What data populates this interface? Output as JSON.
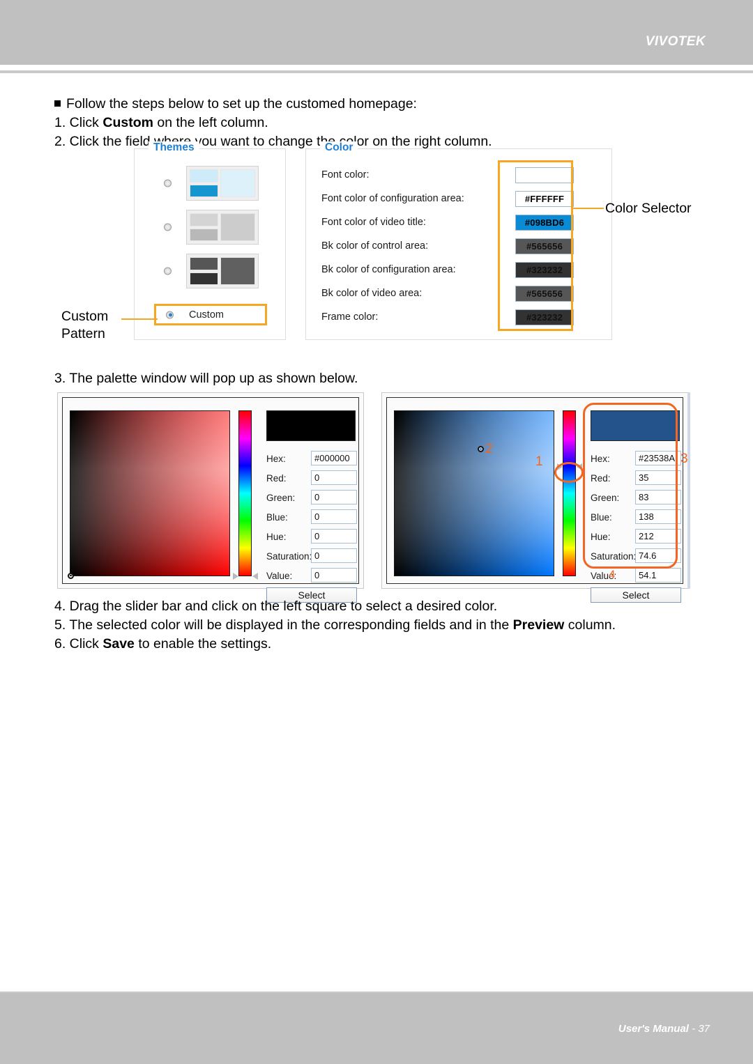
{
  "header": {
    "brand": "VIVOTEK"
  },
  "footer": {
    "text_prefix": "User's Manual",
    "separator": " - ",
    "page": "37"
  },
  "instructions": {
    "intro": "Follow the steps below to set up the customed homepage:",
    "step1_pre": "1. Click ",
    "step1_bold": "Custom",
    "step1_post": " on the left column.",
    "step2": "2. Click the field where you want to change the color on the right column.",
    "step3": "3. The palette window will pop up as shown below.",
    "step4": "4. Drag the slider bar and click on the left square to select a desired color.",
    "step5_pre": "5. The selected color will be displayed in the corresponding fields and in the ",
    "step5_bold": "Preview",
    "step5_post": " column.",
    "step6_pre": "6. Click ",
    "step6_bold": "Save",
    "step6_post": " to enable the settings."
  },
  "themes_panel": {
    "legend": "Themes",
    "items": [
      {
        "name": "theme-blue",
        "selected": false,
        "colors": {
          "top": "#cdebf9",
          "bottom": "#1596cf",
          "right": "#ddf1fb"
        }
      },
      {
        "name": "theme-gray",
        "selected": false,
        "colors": {
          "top": "#d4d4d4",
          "bottom": "#b8b8b8",
          "right": "#cccccc"
        }
      },
      {
        "name": "theme-dark",
        "selected": false,
        "colors": {
          "top": "#565656",
          "bottom": "#333333",
          "right": "#606060"
        }
      }
    ],
    "custom": {
      "label": "Custom",
      "selected": true
    }
  },
  "color_panel": {
    "legend": "Color",
    "rows": [
      {
        "label": "Font color:",
        "value": "",
        "bg": "#ffffff",
        "fg": "#000000"
      },
      {
        "label": "Font color of configuration area:",
        "value": "#FFFFFF",
        "bg": "#ffffff",
        "fg": "#000000"
      },
      {
        "label": "Font color of video title:",
        "value": "#098BD6",
        "bg": "#098bd6",
        "fg": "#000000"
      },
      {
        "label": "Bk color of control area:",
        "value": "#565656",
        "bg": "#565656",
        "fg": "#111111"
      },
      {
        "label": "Bk color of configuration area:",
        "value": "#323232",
        "bg": "#323232",
        "fg": "#111111"
      },
      {
        "label": "Bk color of video area:",
        "value": "#565656",
        "bg": "#565656",
        "fg": "#111111"
      },
      {
        "label": "Frame color:",
        "value": "#323232",
        "bg": "#323232",
        "fg": "#111111"
      }
    ]
  },
  "callouts": {
    "custom_pattern_line1": "Custom",
    "custom_pattern_line2": "Pattern",
    "color_selector": "Color Selector",
    "marks": {
      "one": "1",
      "two": "2",
      "three": "3",
      "four": "4"
    }
  },
  "palette_left": {
    "preview_color": "#000000",
    "hue_degrees": 0,
    "cursor": {
      "x_pct": 0,
      "y_pct": 100
    },
    "handle_pct": 100,
    "fields": [
      {
        "label": "Hex:",
        "value": "#000000"
      },
      {
        "label": "Red:",
        "value": "0"
      },
      {
        "label": "Green:",
        "value": "0"
      },
      {
        "label": "Blue:",
        "value": "0"
      },
      {
        "label": "Hue:",
        "value": "0"
      },
      {
        "label": "Saturation:",
        "value": "0"
      },
      {
        "label": "Value:",
        "value": "0"
      }
    ],
    "select_label": "Select"
  },
  "palette_right": {
    "preview_color": "#23538A",
    "hue_degrees": 212,
    "cursor": {
      "x_pct": 54,
      "y_pct": 23
    },
    "handle_pct": 34,
    "fields": [
      {
        "label": "Hex:",
        "value": "#23538A"
      },
      {
        "label": "Red:",
        "value": "35"
      },
      {
        "label": "Green:",
        "value": "83"
      },
      {
        "label": "Blue:",
        "value": "138"
      },
      {
        "label": "Hue:",
        "value": "212"
      },
      {
        "label": "Saturation:",
        "value": "74.6"
      },
      {
        "label": "Value:",
        "value": "54.1"
      }
    ],
    "select_label": "Select"
  },
  "colors": {
    "header_gray": "#c0c0c0",
    "accent_blue": "#1f7fd4",
    "highlight_orange": "#f5a623",
    "annotation_orange": "#f26522"
  }
}
